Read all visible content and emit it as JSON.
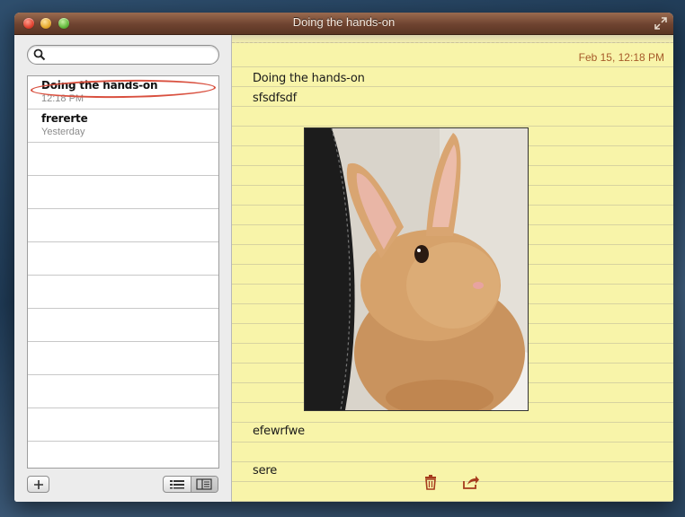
{
  "window": {
    "title": "Doing the hands-on"
  },
  "search": {
    "placeholder": "",
    "value": ""
  },
  "notes": [
    {
      "title": "Doing the hands-on",
      "date": "12:18 PM",
      "selected": true
    },
    {
      "title": "frererte",
      "date": "Yesterday",
      "selected": false
    }
  ],
  "editor": {
    "date": "Feb 15, 12:18 PM",
    "lines": [
      "Doing the hands-on",
      "sfsdfsdf",
      "efewrfwe",
      "sere"
    ]
  },
  "icons": {
    "search": "search-icon",
    "add": "plus-icon",
    "list_view": "list-view-icon",
    "split_view": "split-view-icon",
    "trash": "trash-icon",
    "share": "share-icon",
    "fullscreen": "fullscreen-icon"
  },
  "colors": {
    "titlebar": "#6e4330",
    "paper": "#f8f4a9",
    "selection_ring": "#d9503f",
    "accent_icon": "#a63b1c",
    "date_text": "#a65a2a"
  }
}
